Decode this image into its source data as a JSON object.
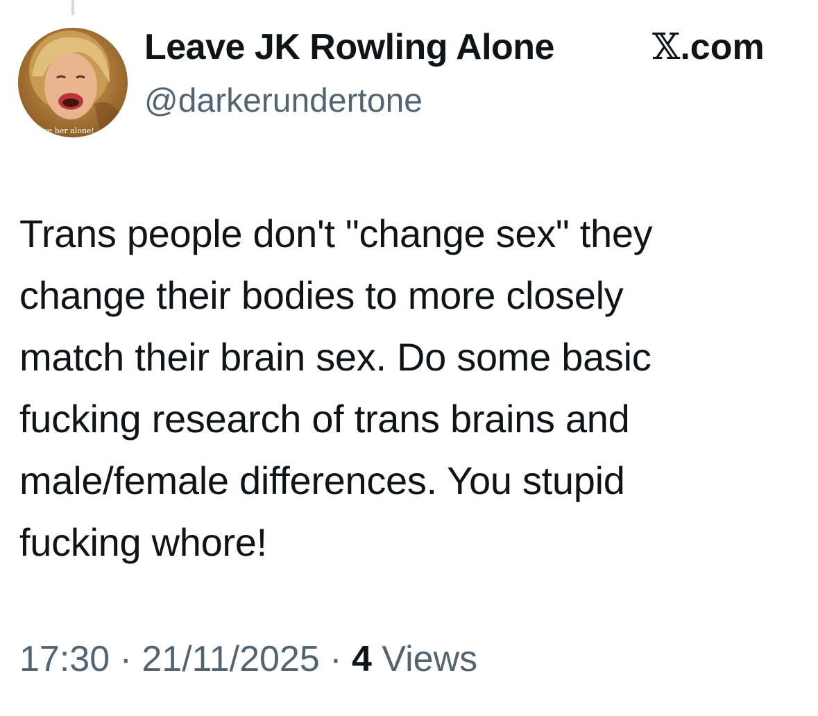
{
  "author": {
    "display_name": "Leave JK Rowling Alone",
    "handle": "@darkerundertone",
    "avatar_caption": "ave her alone!"
  },
  "brand": {
    "x_mark": "𝕏",
    "domain": ".com"
  },
  "tweet": {
    "lines": [
      "Trans people don't \"change sex\" they",
      "change their bodies to more closely",
      "match their brain sex. Do some basic",
      "fucking research of trans brains and",
      "male/female differences. You stupid",
      "fucking whore!"
    ]
  },
  "meta": {
    "time": "17:30",
    "separator": " · ",
    "date": "21/11/2025",
    "views_count": "4",
    "views_label": " Views"
  },
  "colors": {
    "text": "#0f1419",
    "secondary": "#536471",
    "thread_line": "#cfd9de"
  }
}
